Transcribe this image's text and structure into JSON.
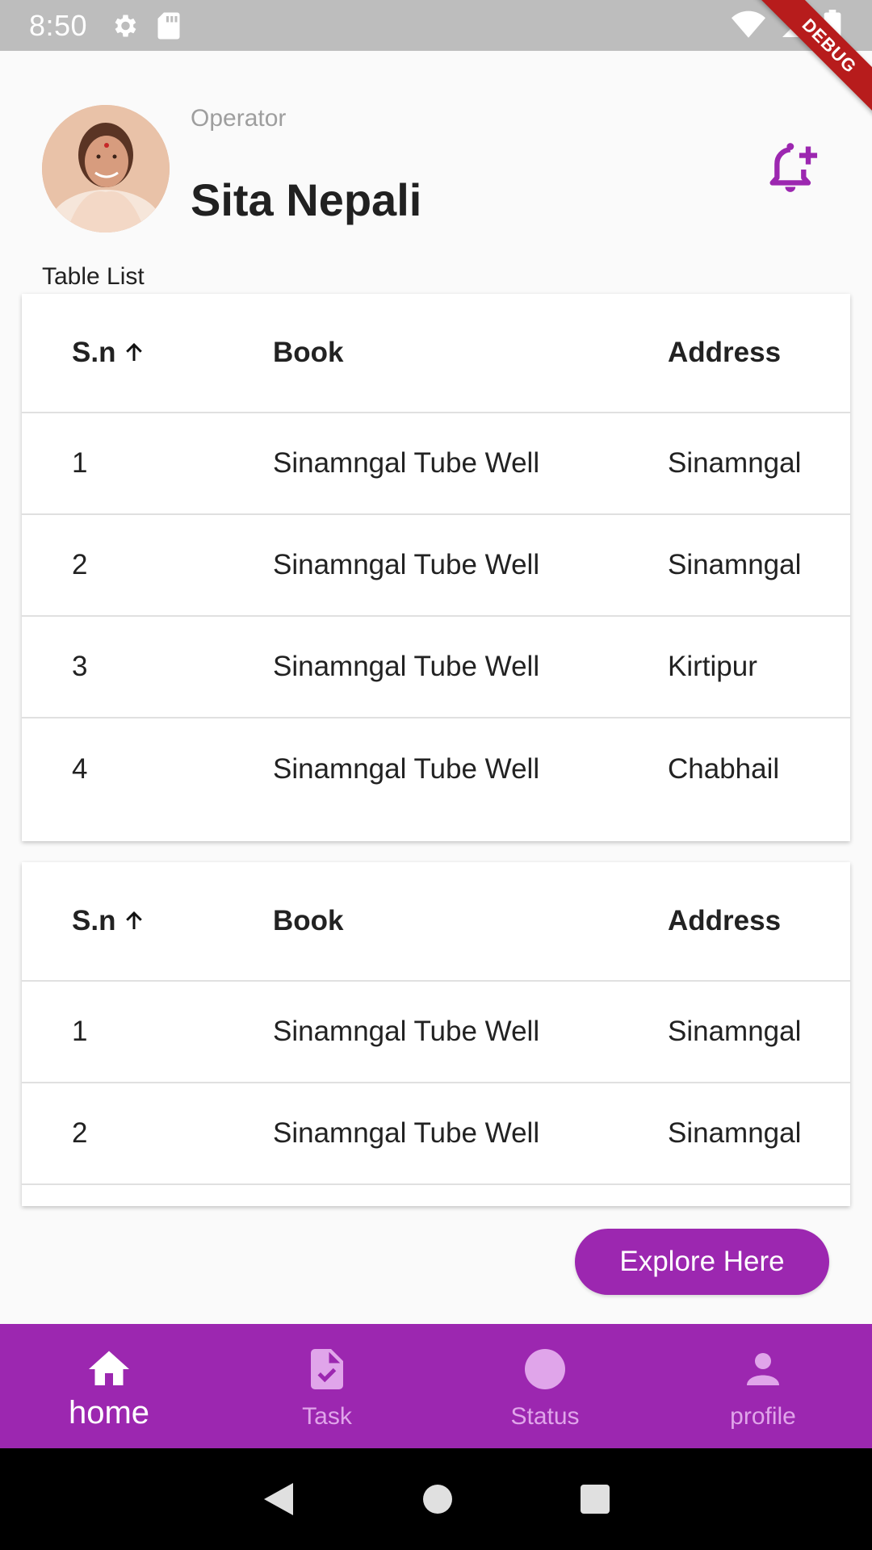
{
  "status_bar": {
    "time": "8:50"
  },
  "debug_ribbon": "DEBUG",
  "header": {
    "role": "Operator",
    "name": "Sita Nepali"
  },
  "section_label": "Table List",
  "tables": [
    {
      "headers": {
        "sn": "S.n",
        "book": "Book",
        "address": "Address"
      },
      "rows": [
        {
          "sn": "1",
          "book": "Sinamngal Tube Well",
          "address": "Sinamngal"
        },
        {
          "sn": "2",
          "book": "Sinamngal Tube Well",
          "address": "Sinamngal"
        },
        {
          "sn": "3",
          "book": "Sinamngal Tube Well",
          "address": "Kirtipur"
        },
        {
          "sn": "4",
          "book": "Sinamngal Tube Well",
          "address": "Chabhail"
        }
      ]
    },
    {
      "headers": {
        "sn": "S.n",
        "book": "Book",
        "address": "Address"
      },
      "rows": [
        {
          "sn": "1",
          "book": "Sinamngal Tube Well",
          "address": "Sinamngal"
        },
        {
          "sn": "2",
          "book": "Sinamngal Tube Well",
          "address": "Sinamngal"
        }
      ]
    }
  ],
  "explore_button": "Explore Here",
  "bottom_nav": [
    {
      "label": "home",
      "icon": "home-icon",
      "active": true
    },
    {
      "label": "Task",
      "icon": "task-icon",
      "active": false
    },
    {
      "label": "Status",
      "icon": "status-icon",
      "active": false
    },
    {
      "label": "profile",
      "icon": "profile-icon",
      "active": false
    }
  ],
  "colors": {
    "accent": "#9c27b0",
    "status_bar": "#bdbdbd",
    "inactive_nav": "#e0a5ea",
    "debug": "#b71c1c"
  }
}
